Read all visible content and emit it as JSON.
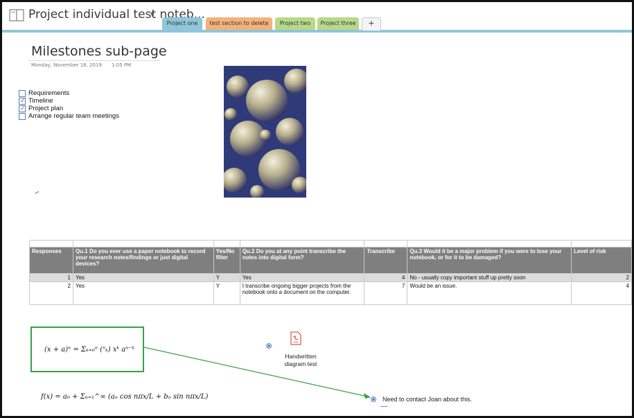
{
  "notebook": {
    "title": "Project individual test noteb...",
    "icon": "notebook-icon",
    "dropdown_icon": "caret-down-icon"
  },
  "tabs": [
    {
      "label": "Project one",
      "color": "#8fc6d9"
    },
    {
      "label": "test section to delete",
      "color": "#f2b27a"
    },
    {
      "label": "Project two",
      "color": "#b7d989"
    },
    {
      "label": "Project three",
      "color": "#b7d989"
    }
  ],
  "add_tab_label": "+",
  "page": {
    "title": "Milestones sub-page",
    "date": "Monday, November 18, 2019",
    "time": "1:05 PM"
  },
  "todos": [
    {
      "label": "Requirements",
      "checked": false
    },
    {
      "label": "Timeline",
      "checked": true
    },
    {
      "label": "Project plan",
      "checked": true
    },
    {
      "label": "Arrange regular team meetings",
      "checked": false
    }
  ],
  "table": {
    "headers": [
      "Responses",
      "Qu.1 Do you ever use a paper notebook to record your research notes/findings or just digital devices?",
      "Yes/No filter",
      "Qu.2 Do you at any point transcribe the notes into digital form?",
      "Transcribe",
      "Qu.3 Would it be a major problem if you were to lose your notebook, or for it to be damaged?",
      "Level of risk"
    ],
    "rows": [
      [
        "1",
        "Yes",
        "Y",
        "Yes",
        "4",
        "No - usually copy important stuff up pretty soon",
        "2"
      ],
      [
        "2",
        "Yes",
        "Y",
        "I transcribe ongoing bigger projects from the notebook onto a document on the computer.",
        "7",
        "Would be an issue.",
        "4"
      ]
    ]
  },
  "formulas": {
    "binomial": "(x + a)ⁿ = Σₖ₌₀ⁿ (ⁿₖ) xᵏ aⁿ⁻ᵏ",
    "fourier": "f(x) = a₀ + Σₙ₌₁^∞ (aₙ cos nπx/L + bₙ sin nπx/L)"
  },
  "attachment": {
    "caption_line1": "Handwritten",
    "caption_line2": "diagram test",
    "icon": "pdf-icon",
    "icon_text": "PDF"
  },
  "note": "Need to contact Joan about this.",
  "colors": {
    "accent_tab": "#8fc6d9",
    "connector": "#37a047",
    "check": "#d9342b",
    "header_bg": "#7f7f7f"
  }
}
